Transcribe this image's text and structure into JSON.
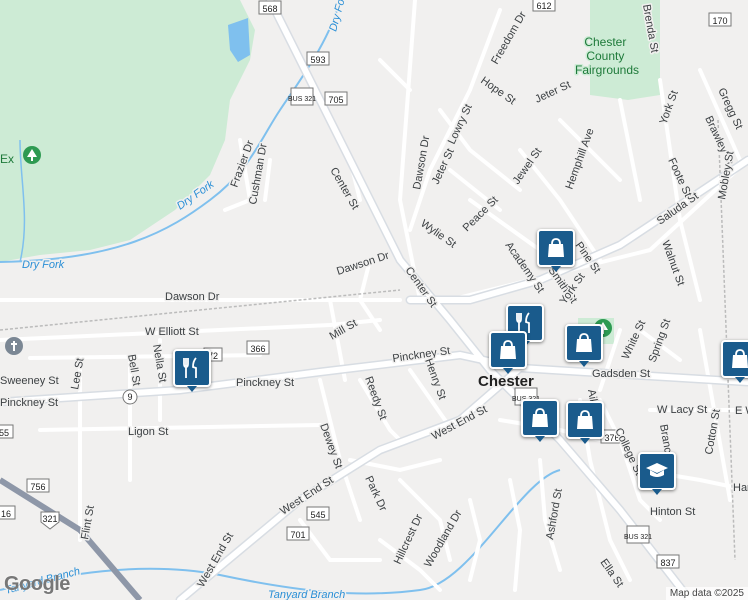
{
  "map": {
    "city_label": "Chester",
    "park_label": "Chester County Fairgrounds",
    "attribution": "Map data ©2025",
    "logo": "Google"
  },
  "streets": [
    {
      "name": "Center St"
    },
    {
      "name": "Dawson Dr"
    },
    {
      "name": "Pinckney St"
    },
    {
      "name": "West End St"
    },
    {
      "name": "Gadsden St"
    },
    {
      "name": "Saluda St"
    },
    {
      "name": "W Elliott St"
    },
    {
      "name": "Mill St"
    },
    {
      "name": "Reedy St"
    },
    {
      "name": "Henry St"
    },
    {
      "name": "Dewey St"
    },
    {
      "name": "Park Dr"
    },
    {
      "name": "Hillcrest Dr"
    },
    {
      "name": "Woodland Dr"
    },
    {
      "name": "Ashford St"
    },
    {
      "name": "Ligon St"
    },
    {
      "name": "Frazier Dr"
    },
    {
      "name": "Cushman Dr"
    },
    {
      "name": "Wylie St"
    },
    {
      "name": "Peace St"
    },
    {
      "name": "Jeter St"
    },
    {
      "name": "Lowry St"
    },
    {
      "name": "Hope St"
    },
    {
      "name": "Freedom Dr"
    },
    {
      "name": "Jeter St"
    },
    {
      "name": "Jewel St"
    },
    {
      "name": "Hemphill Ave"
    },
    {
      "name": "York St"
    },
    {
      "name": "Foote St"
    },
    {
      "name": "Walnut St"
    },
    {
      "name": "Brawley St"
    },
    {
      "name": "Gregg St"
    },
    {
      "name": "Mobley St"
    },
    {
      "name": "Academy St"
    },
    {
      "name": "Smith St"
    },
    {
      "name": "York St"
    },
    {
      "name": "Pine St"
    },
    {
      "name": "White St"
    },
    {
      "name": "Spring St"
    },
    {
      "name": "Aiken St"
    },
    {
      "name": "College St"
    },
    {
      "name": "W Lacy St"
    },
    {
      "name": "Cotton St"
    },
    {
      "name": "Hinton St"
    },
    {
      "name": "Branch St"
    },
    {
      "name": "Ella St"
    },
    {
      "name": "Flint St"
    },
    {
      "name": "Lee St"
    },
    {
      "name": "Bell St"
    },
    {
      "name": "Nella St"
    },
    {
      "name": "Sweeney St"
    },
    {
      "name": "Brenda St"
    }
  ],
  "water": [
    {
      "name": "Dry Fork"
    },
    {
      "name": "Dry Fork"
    },
    {
      "name": "Dry Fork"
    },
    {
      "name": "Tanyard Branch"
    },
    {
      "name": "Tanyard Branch"
    }
  ],
  "shields": [
    "568",
    "612",
    "170",
    "593",
    "BUS 321",
    "705",
    "72",
    "366",
    "9",
    "BUS 321",
    "376",
    "545",
    "701",
    "756",
    "321",
    "837",
    "BUS 321",
    "16",
    "55"
  ],
  "partial_labels": [
    "Ex",
    "E W",
    "Har",
    "rest"
  ],
  "pins": [
    {
      "type": "restaurant",
      "icon": "fork-knife-icon"
    },
    {
      "type": "restaurant",
      "icon": "fork-knife-icon"
    },
    {
      "type": "shopping",
      "icon": "shopping-bag-icon"
    },
    {
      "type": "shopping",
      "icon": "shopping-bag-icon"
    },
    {
      "type": "shopping",
      "icon": "shopping-bag-icon"
    },
    {
      "type": "shopping",
      "icon": "shopping-bag-icon"
    },
    {
      "type": "shopping",
      "icon": "shopping-bag-icon"
    },
    {
      "type": "shopping",
      "icon": "shopping-bag-icon"
    },
    {
      "type": "shopping",
      "icon": "shopping-bag-icon"
    },
    {
      "type": "school",
      "icon": "graduation-cap-icon"
    }
  ],
  "colors": {
    "pin": "#1a5b8c",
    "park": "#cdebd5",
    "water": "#7fc0ee",
    "road": "#ffffff",
    "major_road": "#d8dde3"
  }
}
